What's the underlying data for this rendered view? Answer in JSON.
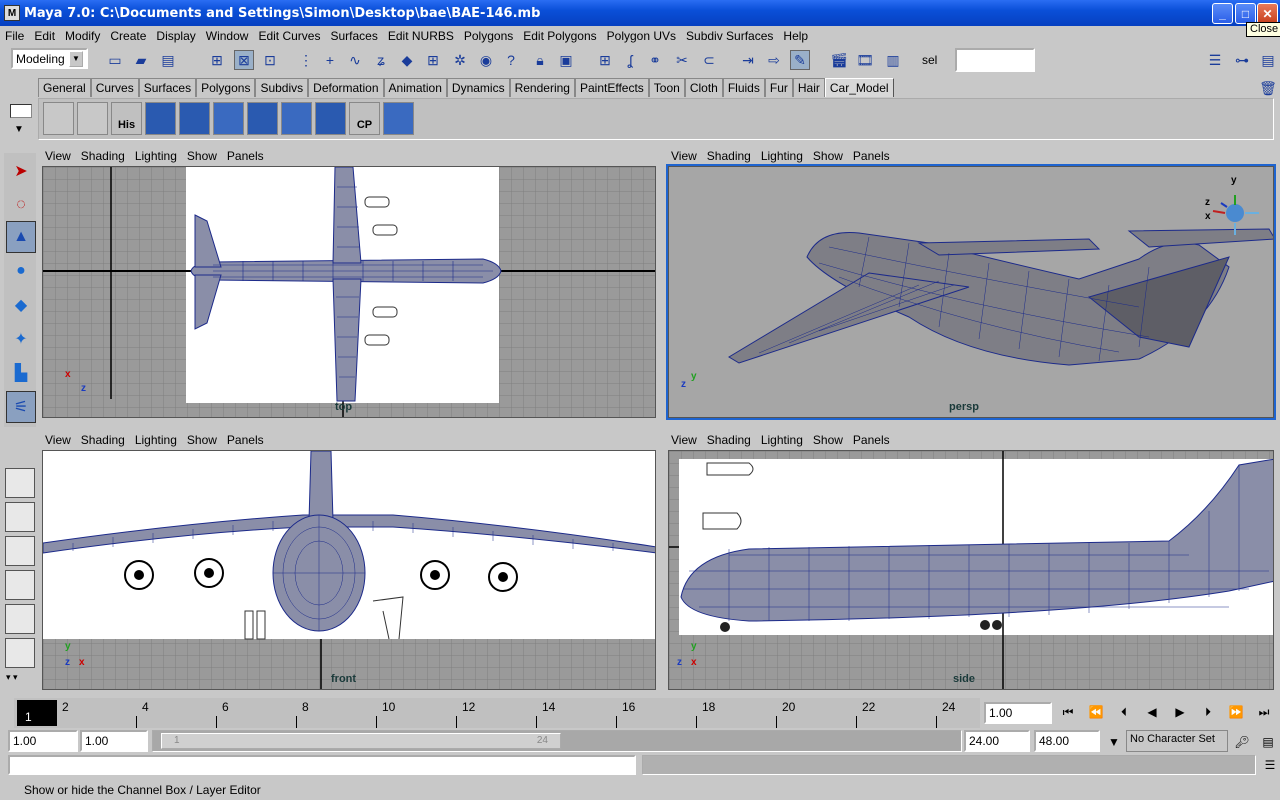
{
  "window": {
    "title": "Maya 7.0: C:\\Documents and Settings\\Simon\\Desktop\\bae\\BAE-146.mb",
    "app_icon": "M",
    "tooltip": "Close"
  },
  "menu": [
    "File",
    "Edit",
    "Modify",
    "Create",
    "Display",
    "Window",
    "Edit Curves",
    "Surfaces",
    "Edit NURBS",
    "Polygons",
    "Edit Polygons",
    "Polygon UVs",
    "Subdiv Surfaces",
    "Help"
  ],
  "status": {
    "mode": "Modeling",
    "sel_label": "sel",
    "sel_value": ""
  },
  "shelf_tabs": [
    {
      "label": "General"
    },
    {
      "label": "Curves"
    },
    {
      "label": "Surfaces"
    },
    {
      "label": "Polygons"
    },
    {
      "label": "Subdivs"
    },
    {
      "label": "Deformation"
    },
    {
      "label": "Animation"
    },
    {
      "label": "Dynamics"
    },
    {
      "label": "Rendering"
    },
    {
      "label": "PaintEffects"
    },
    {
      "label": "Toon"
    },
    {
      "label": "Cloth"
    },
    {
      "label": "Fluids"
    },
    {
      "label": "Fur"
    },
    {
      "label": "Hair"
    },
    {
      "label": "Car_Model",
      "active": true
    }
  ],
  "shelf_labels": {
    "his": "His",
    "cp": "CP"
  },
  "panel_menu": [
    "View",
    "Shading",
    "Lighting",
    "Show",
    "Panels"
  ],
  "viewports": {
    "top": {
      "label": "top",
      "axis_a": "x",
      "axis_b": "z"
    },
    "persp": {
      "label": "persp",
      "axis_a": "y",
      "axis_b": "z",
      "cube_y": "y",
      "cube_z": "z",
      "cube_x": "x"
    },
    "front": {
      "label": "front",
      "axis_a": "y",
      "axis_b": "z",
      "axis_c": "x"
    },
    "side": {
      "label": "side",
      "axis_a": "y",
      "axis_b": "z",
      "axis_c": "x"
    }
  },
  "timeline": {
    "current_frame": "1",
    "ticks": [
      "2",
      "4",
      "6",
      "8",
      "10",
      "12",
      "14",
      "16",
      "18",
      "20",
      "22",
      "24"
    ],
    "current_time": "1.00"
  },
  "range": {
    "start": "1.00",
    "playback_start": "1.00",
    "slider_start": "1",
    "slider_end": "24",
    "playback_end": "24.00",
    "end": "48.00",
    "character_set": "No Character Set"
  },
  "help_line": "Show or hide the Channel Box / Layer Editor",
  "colors": {
    "wire": "#1c2a8a",
    "grid_bg": "#9a9a9a",
    "active_border": "#1e64d0"
  }
}
